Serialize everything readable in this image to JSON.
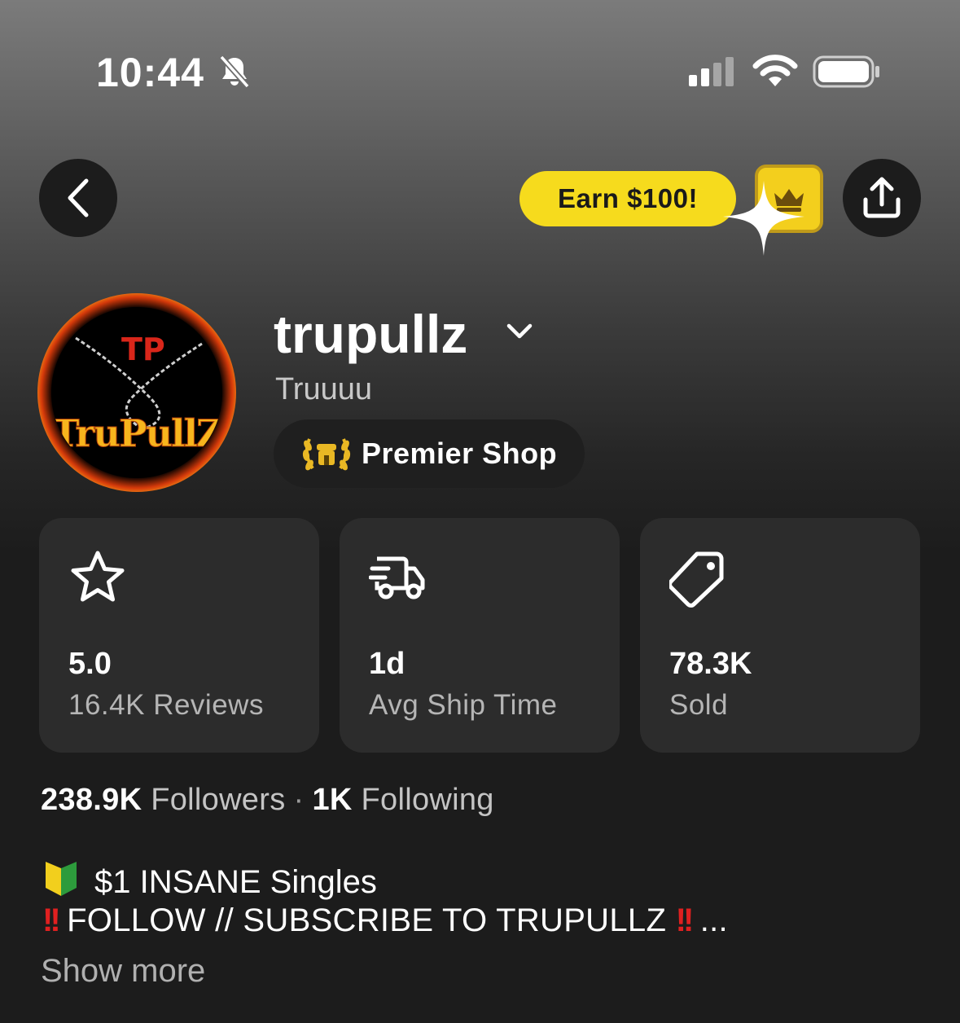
{
  "status_bar": {
    "time": "10:44",
    "icons": [
      "bell-slash-icon",
      "cellular-signal-icon",
      "wifi-icon",
      "battery-icon"
    ]
  },
  "header": {
    "earn_label": "Earn $100!",
    "icons": [
      "back-arrow-icon",
      "crown-icon",
      "share-icon"
    ]
  },
  "profile": {
    "username": "trupullz",
    "display_name": "Truuuu",
    "badge_label": "Premier Shop",
    "avatar_text": "TruPullZ",
    "avatar_mark": "TP"
  },
  "stats": [
    {
      "icon": "star-icon",
      "value": "5.0",
      "label": "16.4K Reviews"
    },
    {
      "icon": "delivery-truck-icon",
      "value": "1d",
      "label": "Avg Ship Time"
    },
    {
      "icon": "price-tag-icon",
      "value": "78.3K",
      "label": "Sold"
    }
  ],
  "social": {
    "followers_count": "238.9K",
    "followers_label": "Followers",
    "separator": "·",
    "following_count": "1K",
    "following_label": "Following"
  },
  "bio": {
    "line1_emoji": "🔰",
    "line1_text": "$1 INSANE Singles",
    "line2_prefix": "‼️",
    "line2_text": "FOLLOW // SUBSCRIBE TO TRUPULLZ",
    "line2_suffix": "‼️",
    "ellipsis": "...",
    "show_more": "Show more"
  },
  "colors": {
    "accent_yellow": "#f6db1d",
    "card_bg": "#2c2c2c",
    "page_bg": "#1c1c1c"
  }
}
